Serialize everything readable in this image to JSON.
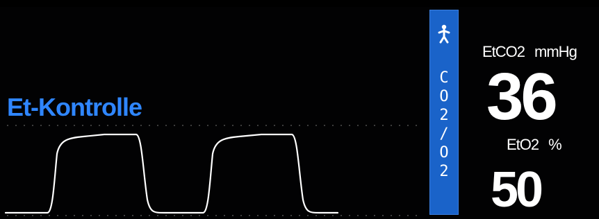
{
  "waveform_panel": {
    "mode_label": "Et-Kontrolle",
    "colors": {
      "waveform": "#ffffff",
      "mode_label": "#2f86ff",
      "dotted_reference": "#3d3d3d"
    }
  },
  "param_tab": {
    "icon": "patient-icon",
    "characters": [
      "C",
      "O",
      "2",
      "/",
      "O",
      "2"
    ],
    "color": "#1a63c9"
  },
  "etco2": {
    "label": "EtCO2",
    "unit": "mmHg",
    "value": "36"
  },
  "eto2": {
    "label": "EtO2",
    "unit": "%",
    "value": "50"
  }
}
